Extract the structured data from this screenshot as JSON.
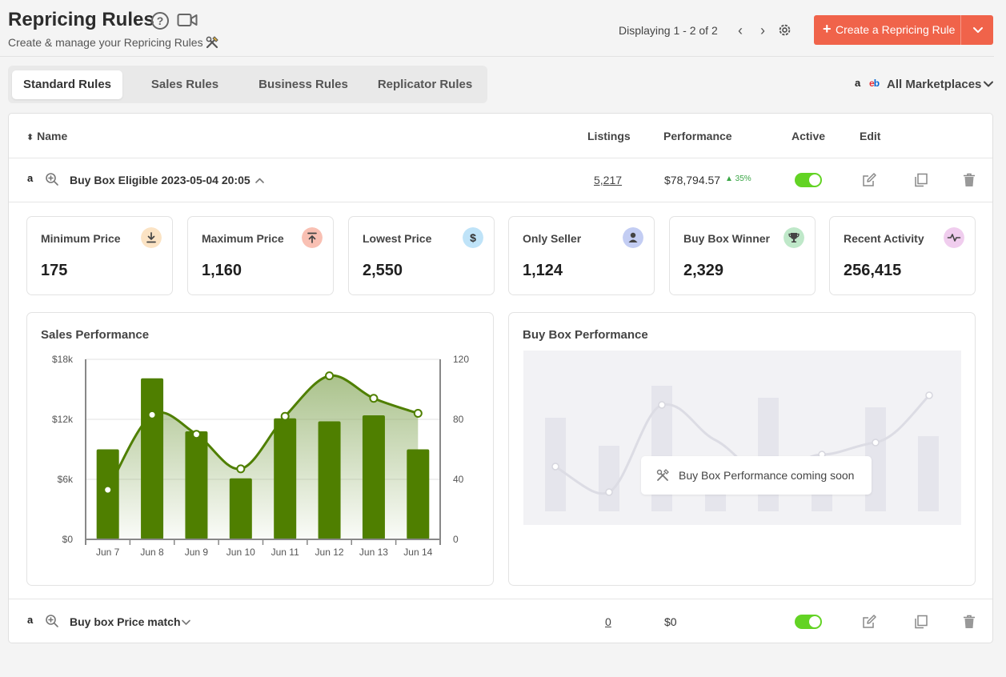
{
  "header": {
    "title": "Repricing Rules",
    "subtitle": "Create & manage your Repricing Rules",
    "displaying": "Displaying 1 - 2 of 2",
    "create_button": "Create a Repricing Rule",
    "create_plus": "+"
  },
  "help_glyph": "?",
  "pager": {
    "prev": "‹",
    "next": "›"
  },
  "tabs": [
    "Standard Rules",
    "Sales Rules",
    "Business Rules",
    "Replicator Rules"
  ],
  "marketplaces": {
    "amazon_glyph": "a",
    "ebay_glyph": "eb",
    "label": "All Marketplaces"
  },
  "table": {
    "headers": {
      "name": "Name",
      "sort_glyph": "⬍",
      "listings": "Listings",
      "performance": "Performance",
      "active": "Active",
      "edit": "Edit"
    },
    "rows": [
      {
        "marketplace": "a",
        "name": "Buy Box Eligible 2023-05-04 20:05",
        "listings": "5,217",
        "performance": "$78,794.57",
        "change": "▲ 35%",
        "active": true,
        "expanded": true
      },
      {
        "marketplace": "a",
        "name": "Buy box Price match",
        "listings": "0",
        "performance": "$0",
        "change": "",
        "active": true,
        "expanded": false
      }
    ]
  },
  "stats": [
    {
      "label": "Minimum Price",
      "value": "175",
      "icon": "download-icon",
      "color": "#fbe3c4"
    },
    {
      "label": "Maximum Price",
      "value": "1,160",
      "icon": "upload-icon",
      "color": "#f9c0b3"
    },
    {
      "label": "Lowest Price",
      "value": "2,550",
      "icon": "dollar-icon",
      "color": "#bfe3f8"
    },
    {
      "label": "Only Seller",
      "value": "1,124",
      "icon": "user-icon",
      "color": "#c3cdf3"
    },
    {
      "label": "Buy Box Winner",
      "value": "2,329",
      "icon": "trophy-icon",
      "color": "#bfe8c9"
    },
    {
      "label": "Recent Activity",
      "value": "256,415",
      "icon": "activity-icon",
      "color": "#f0cdee"
    }
  ],
  "sales_performance": {
    "title": "Sales Performance"
  },
  "buy_box_performance": {
    "title": "Buy Box Performance",
    "message": "Buy Box Performance coming soon"
  },
  "chart_data": {
    "type": "bar",
    "title": "Sales Performance",
    "categories": [
      "Jun 7",
      "Jun 8",
      "Jun 9",
      "Jun 10",
      "Jun 11",
      "Jun 12",
      "Jun 13",
      "Jun 14"
    ],
    "ylim": [
      0,
      18000
    ],
    "y2lim": [
      0,
      120
    ],
    "left_ticks": [
      "$0",
      "$6k",
      "$12k",
      "$18k"
    ],
    "right_ticks": [
      "0",
      "40",
      "80",
      "120"
    ],
    "grid": true,
    "series": [
      {
        "type": "bar",
        "axis": "left",
        "color": "#4f7f00",
        "values": [
          9000,
          16100,
          10800,
          6100,
          12100,
          11800,
          12400,
          9000
        ]
      },
      {
        "type": "area",
        "axis": "right",
        "color": "#4f7f00",
        "values": [
          33,
          83,
          70,
          47,
          82,
          109,
          94,
          84
        ]
      }
    ]
  }
}
